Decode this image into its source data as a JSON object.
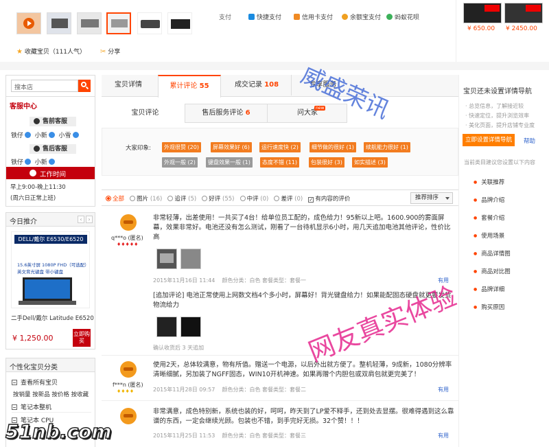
{
  "top": {
    "thumbs": 7,
    "payment_label": "支付",
    "payments": [
      {
        "label": "快捷支付",
        "color": "#1a8be0"
      },
      {
        "label": "信用卡支付",
        "color": "#f08a24"
      },
      {
        "label": "余额宝支付",
        "color": "#f0a020"
      },
      {
        "label": "蚂蚁花呗",
        "color": "#3cb15a"
      }
    ],
    "favorite": "收藏宝贝（111人气）",
    "share": "分享",
    "recommend": [
      {
        "price": "¥ 650.00"
      },
      {
        "price": "¥ 2450.00"
      }
    ]
  },
  "left": {
    "search_placeholder": "搜本店",
    "service_title": "客服中心",
    "presale_label": "售前客服",
    "presale_agents": [
      "铁仔",
      "小新",
      "小雪"
    ],
    "aftersale_label": "售后客服",
    "aftersale_agents": [
      "铁仔",
      "小新"
    ],
    "work_time_label": "工作时间",
    "work_hours": "早上9:00-晚上11:30",
    "work_note": "(周六日正常上班)",
    "today_title": "今日推介",
    "product_banner_title": "DELL/戴尔 E6530/E6520",
    "product_banner_sub": "15.6英寸屏 1080P FHD（可选配）",
    "product_banner_sub2": "英文背光键盘 带小键盘",
    "product_name": "二手Dell/戴尔 Latitude E6520",
    "product_price": "¥ 1,250.00",
    "buy_now": "立即购买",
    "category_title": "个性化宝贝分类",
    "categories": [
      {
        "label": "查看所有宝贝"
      },
      {
        "label": "按销量 按新品 按价格 按收藏"
      },
      {
        "label": "笔记本整机"
      },
      {
        "label": "笔记本 CPU"
      }
    ]
  },
  "main": {
    "tabs": [
      {
        "label": "宝贝详情",
        "count": ""
      },
      {
        "label": "累计评论",
        "count": "55"
      },
      {
        "label": "成交记录",
        "count": "108"
      },
      {
        "label": "专享服务",
        "count": ""
      }
    ],
    "subtabs": [
      {
        "label": "宝贝评论",
        "count": ""
      },
      {
        "label": "售后服务评论",
        "count": "6"
      },
      {
        "label": "问大家",
        "count": ""
      }
    ],
    "new_badge": "new",
    "impression_label": "大家印象:",
    "impressions": [
      {
        "label": "外观很赞 (20)",
        "style": "o"
      },
      {
        "label": "屏幕效果好 (6)",
        "style": "o"
      },
      {
        "label": "运行速度快 (2)",
        "style": "o"
      },
      {
        "label": "细节做的很好 (1)",
        "style": "o"
      },
      {
        "label": "续航能力很好 (1)",
        "style": "o"
      },
      {
        "label": "外观一般 (2)",
        "style": "g"
      },
      {
        "label": "键盘效果一般 (1)",
        "style": "g"
      },
      {
        "label": "态度不错 (11)",
        "style": "o"
      },
      {
        "label": "包装很好 (3)",
        "style": "o"
      },
      {
        "label": "如实描述 (3)",
        "style": "o"
      }
    ],
    "filters": [
      {
        "label": "全部",
        "count": ""
      },
      {
        "label": "图片",
        "count": "(16)"
      },
      {
        "label": "追评",
        "count": "(5)"
      },
      {
        "label": "好评",
        "count": "(55)"
      },
      {
        "label": "中评",
        "count": "(0)"
      },
      {
        "label": "差评",
        "count": "(0)"
      }
    ],
    "content_filter": "有内容的评价",
    "sort_label": "推荐排序",
    "reviews": [
      {
        "user": "q***o (匿名)",
        "text": "非常轻薄，出差使用！一共买了4台！给单位员工配的，成色给力！95新以上吧。1600.900的雾面屏幕，效果非常好。电池还没有怎么测试，刚看了一台待机显示6小时，用几天追加电池其他评论，性价比高",
        "date": "2015年11月16日 11:44",
        "meta": "颜色分类：白色    套餐类型：套餐一",
        "useful": "有用",
        "append": "[追加评论] 电池正常使用上网数文档4个多小时，屏幕好！背光键盘给力！如果能配固态硬盘就更要发货物流给力",
        "append_meta": "确认收货后 3 天追加"
      },
      {
        "user": "f***n (匿名)",
        "text": "使用2天，总体较满意，物有所值。赠送一个电源，以后外出就方便了。整机轻薄，9成新，1080分辨率清晰细腻，另加装了NGFF固态，WIN10开机神速。如果再赠个内胆包或双肩包就更完美了！",
        "date": "2015年11月28日 09:57",
        "meta": "颜色分类：白色    套餐类型：套餐二",
        "useful": "有用"
      },
      {
        "user": "",
        "text": "非常满意，成色特别新，系统也装的好，呵呵，昨天到了LP爱不释手，还到处去显摆。很难得遇到这么靠谱的东西，一定会继续光顾。包装也不错，到手完好无损。32个赞！！！",
        "date": "2015年11月25日 11:53",
        "meta": "颜色分类：白色    套餐类型：套餐三",
        "useful": "有用"
      }
    ]
  },
  "right": {
    "title": "宝贝还未设置详情导航",
    "tips": [
      "总览信息，了解接近较",
      "快速定位，提升浏览效率",
      "美化页面，提升店铺专业度"
    ],
    "setup_button": "立即设置详情导航",
    "help": "帮助",
    "suggest": "当前类目建议您设置以下内容",
    "links": [
      "关联推荐",
      "品牌介绍",
      "套餐介绍",
      "使用场景",
      "商品详情图",
      "商品对比图",
      "品牌详细",
      "购买原因"
    ]
  },
  "watermarks": {
    "shop": "威盛荣讯",
    "slogan": "网友真实体验",
    "site": "51nb.com"
  },
  "colors": {
    "accent": "#ff4400",
    "orange": "#ff7e00",
    "service_red": "#c4000d"
  }
}
